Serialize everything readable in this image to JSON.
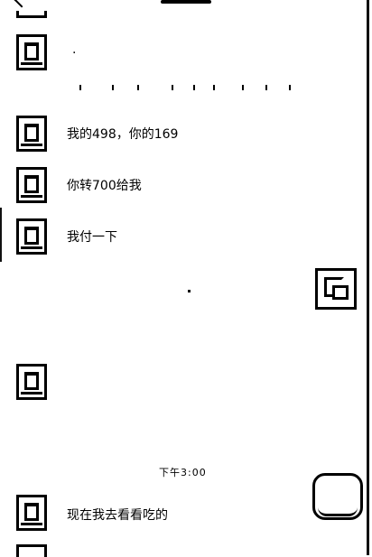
{
  "chat": {
    "messages": [
      {
        "side": "left",
        "text": "·"
      },
      {
        "side": "left",
        "text": "我的498，你的169"
      },
      {
        "side": "left",
        "text": "你转700给我"
      },
      {
        "side": "left",
        "text": "我付一下"
      },
      {
        "side": "right",
        "text": ""
      },
      {
        "side": "left",
        "text": ""
      },
      {
        "side": "left",
        "text": "现在我去看看吃的"
      }
    ],
    "timestamp": "下午3:00"
  },
  "icons": {
    "back": "chevron-left-icon",
    "floating_action": "transfer-icon",
    "input_bubble": "chat-bubble-icon"
  }
}
